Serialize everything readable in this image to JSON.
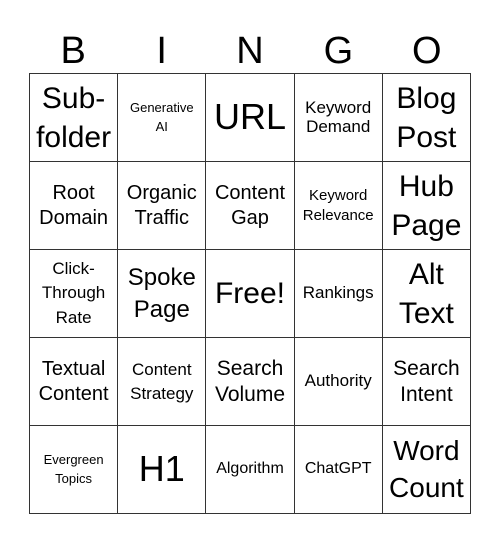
{
  "header": {
    "letters": [
      "B",
      "I",
      "N",
      "G",
      "O"
    ]
  },
  "card": {
    "cells": [
      [
        "Sub-\nfolder",
        "Generative\nAI",
        "URL",
        "Keyword\nDemand",
        "Blog\nPost"
      ],
      [
        "Root\nDomain",
        "Organic\nTraffic",
        "Content\nGap",
        "Keyword\nRelevance",
        "Hub\nPage"
      ],
      [
        "Click-\nThrough\nRate",
        "Spoke\nPage",
        "Free!",
        "Rankings",
        "Alt\nText"
      ],
      [
        "Textual\nContent",
        "Content\nStrategy",
        "Search\nVolume",
        "Authority",
        "Search\nIntent"
      ],
      [
        "Evergreen\nTopics",
        "H1",
        "Algorithm",
        "ChatGPT",
        "Word\nCount"
      ]
    ]
  }
}
